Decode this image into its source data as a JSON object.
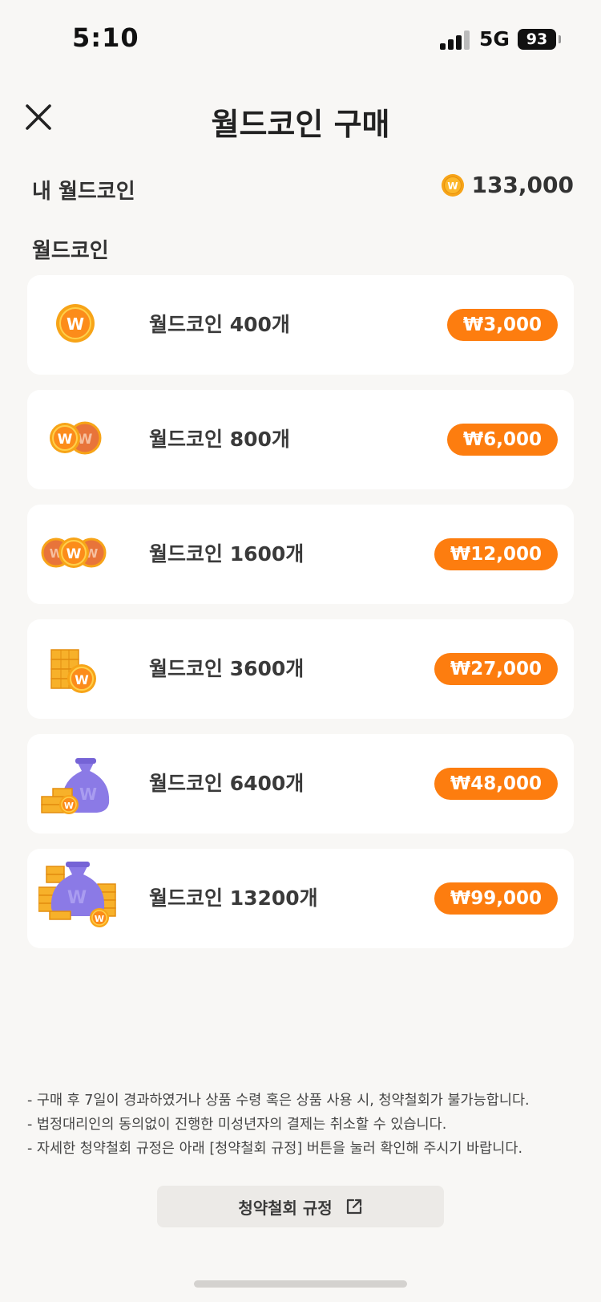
{
  "status_bar": {
    "time": "5:10",
    "network": "5G",
    "battery": "93",
    "icons": [
      "signal-icon",
      "battery-icon"
    ]
  },
  "header": {
    "title": "월드코인 구매",
    "close_icon": "close-icon"
  },
  "balance": {
    "label": "내 월드코인",
    "value": "133,000",
    "coin_icon": "coin-icon"
  },
  "section": {
    "title": "월드코인"
  },
  "products": [
    {
      "name": "월드코인 400개",
      "price": "₩3,000",
      "icon": "single-coin-icon"
    },
    {
      "name": "월드코인 800개",
      "price": "₩6,000",
      "icon": "two-coins-icon"
    },
    {
      "name": "월드코인 1600개",
      "price": "₩12,000",
      "icon": "three-coins-icon"
    },
    {
      "name": "월드코인 3600개",
      "price": "₩27,000",
      "icon": "coin-stack-icon"
    },
    {
      "name": "월드코인 6400개",
      "price": "₩48,000",
      "icon": "coin-bag-icon"
    },
    {
      "name": "월드코인 13200개",
      "price": "₩99,000",
      "icon": "coin-bag-large-icon"
    }
  ],
  "notes": [
    "- 구매 후 7일이 경과하였거나 상품 수령 혹은 상품 사용 시, 청약철회가 불가능합니다.",
    "- 법정대리인의 동의없이 진행한 미성년자의 결제는 취소할 수 있습니다.",
    "- 자세한 청약철회 규정은 아래 [청약철회 규정] 버튼을 눌러 확인해 주시기 바랍니다."
  ],
  "policy_button": {
    "label": "청약철회 규정",
    "icon": "external-link-icon"
  },
  "colors": {
    "accent": "#fd7d0f",
    "coin_gold": "#f7a418",
    "bag_purple": "#8b7ae6",
    "background": "#f8f7f5"
  }
}
